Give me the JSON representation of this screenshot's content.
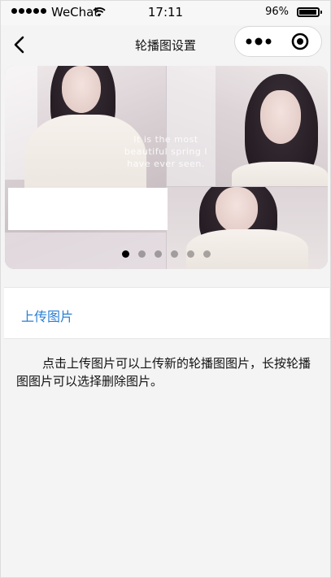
{
  "status_bar": {
    "carrier": "WeChat",
    "time": "17:11",
    "battery_percent_text": "96%",
    "battery_level": 0.96,
    "signal_icon": "signal-dots-icon",
    "wifi_icon": "wifi-icon",
    "battery_icon": "battery-icon"
  },
  "nav": {
    "title": "轮播图设置",
    "back_icon": "chevron-left-icon",
    "more_icon": "more-dots-icon",
    "close_icon": "target-close-icon"
  },
  "banner": {
    "overlay_text": "It is the most beautiful spring I have ever seen.",
    "slide_count": 6,
    "active_slide": 1,
    "dots": [
      "",
      "",
      "",
      "",
      "",
      ""
    ]
  },
  "upload": {
    "label": "上传图片"
  },
  "hint": {
    "text": "点击上传图片可以上传新的轮播图图片，长按轮播图图片可以选择删除图片。"
  },
  "colors": {
    "link": "#2a7fd4",
    "background": "#f4f4f4",
    "panel": "#ffffff",
    "active_dot": "#000000"
  }
}
